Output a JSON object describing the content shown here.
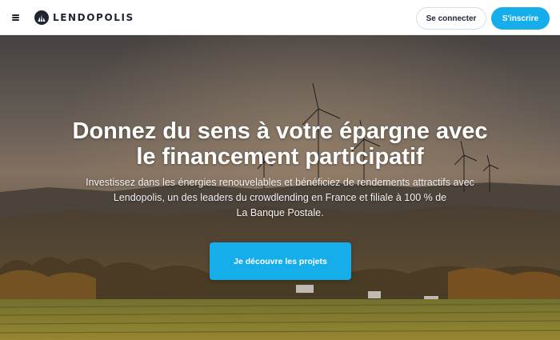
{
  "header": {
    "menu_icon": "hamburger-icon",
    "logo_icon": "lendopolis-wind-turbine-logo",
    "brand": "LENDOPOLIS",
    "login_label": "Se connecter",
    "signup_label": "S'inscrire"
  },
  "hero": {
    "title_line1": "Donnez du sens à votre épargne avec",
    "title_line2": "le financement participatif",
    "subtitle_line1": "Investissez dans les énergies renouvelables et bénéficiez de rendements attractifs avec",
    "subtitle_line2": "Lendopolis, un des leaders du crowdlending en France et filiale à 100 % de",
    "subtitle_line3": "La Banque Postale.",
    "cta_label": "Je découvre les projets",
    "background": "wind-turbines-vineyard-sunset-photo"
  },
  "colors": {
    "accent": "#16adeb",
    "text_dark": "#1e2432",
    "header_bg": "#ffffff"
  }
}
